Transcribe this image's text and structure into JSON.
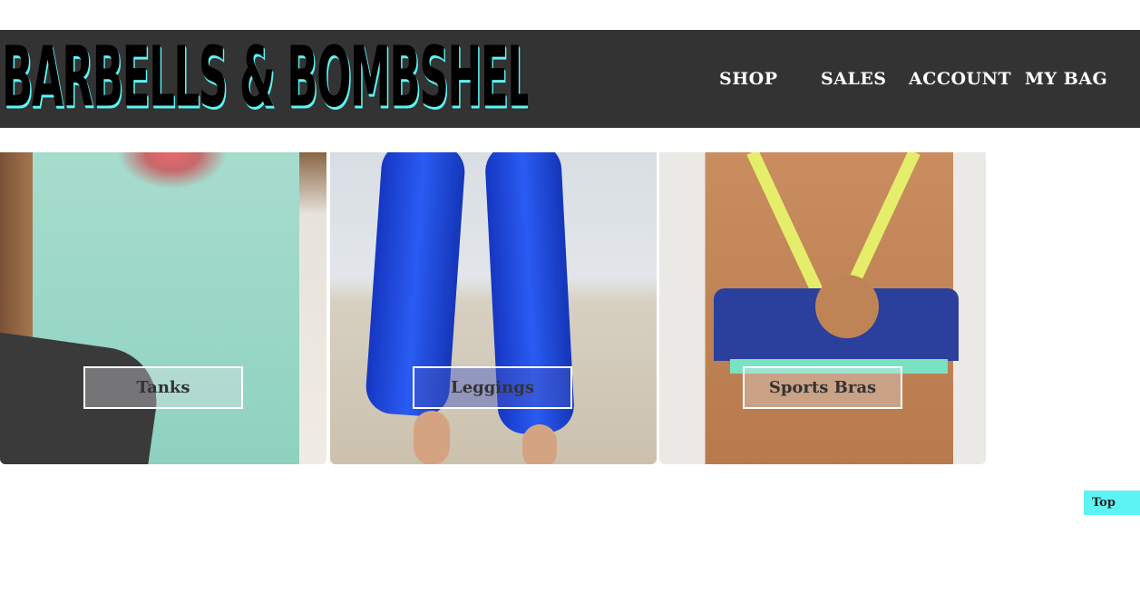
{
  "header": {
    "logo_text": "BARBELLS & BOMBSHELLS",
    "nav": {
      "shop": "SHOP",
      "sales": "SALES",
      "account": "ACCOUNT",
      "bag": "MY BAG"
    }
  },
  "categories": [
    {
      "label": "Tanks"
    },
    {
      "label": "Leggings"
    },
    {
      "label": "Sports Bras"
    }
  ],
  "top_button": "Top",
  "colors": {
    "header_bg": "#333333",
    "accent": "#5ef3f3",
    "nav_text": "#ffffff"
  }
}
